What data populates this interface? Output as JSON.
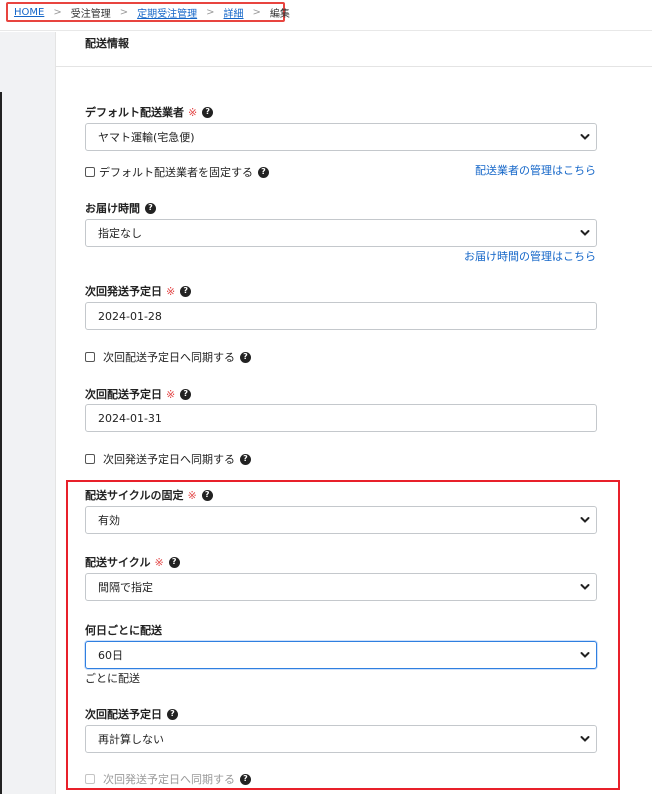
{
  "breadcrumb": {
    "home": "HOME",
    "order_mgmt": "受注管理",
    "recurring_mgmt": "定期受注管理",
    "detail": "詳細",
    "current": "編集",
    "separator": ">"
  },
  "section_title": "配送情報",
  "required_mark": "※",
  "help_glyph": "?",
  "default_carrier": {
    "label": "デフォルト配送業者",
    "value": "ヤマト運輸(宅急便)",
    "fix_checkbox_label": "デフォルト配送業者を固定する",
    "manage_link": "配送業者の管理はこちら"
  },
  "delivery_time": {
    "label": "お届け時間",
    "value": "指定なし",
    "manage_link": "お届け時間の管理はこちら"
  },
  "next_ship_date": {
    "label": "次回発送予定日",
    "value": "2024-01-28",
    "sync_label": "次回配送予定日へ同期する"
  },
  "next_delivery_date": {
    "label": "次回配送予定日",
    "value": "2024-01-31",
    "sync_label": "次回発送予定日へ同期する"
  },
  "cycle_fixed": {
    "label": "配送サイクルの固定",
    "value": "有効"
  },
  "cycle": {
    "label": "配送サイクル",
    "value": "間隔で指定"
  },
  "interval_days": {
    "label": "何日ごとに配送",
    "value": "60日",
    "suffix": "ごとに配送"
  },
  "next_delivery_recalc": {
    "label": "次回配送予定日",
    "value": "再計算しない",
    "sync_label": "次回発送予定日へ同期する"
  },
  "colors": {
    "link": "#1466c8",
    "required": "#e34a4a",
    "highlight": "#e8202a",
    "focus": "#2f7fe0"
  }
}
